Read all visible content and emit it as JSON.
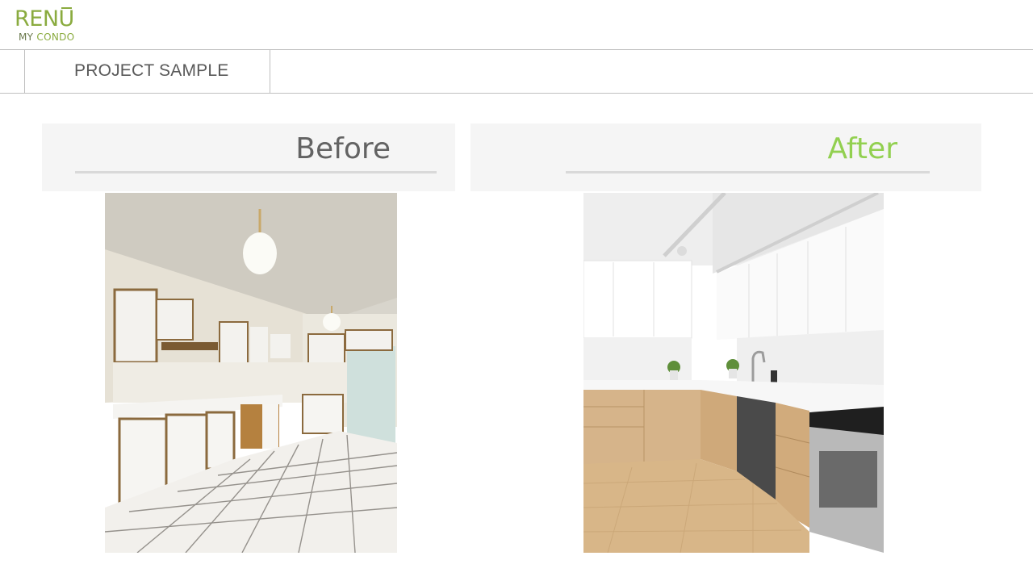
{
  "logo": {
    "brand_prefix": "REN",
    "brand_suffix": "U",
    "tagline_my": "MY",
    "tagline_condo": "CONDO",
    "color": "#8aab3f"
  },
  "header": {
    "section_title": "PROJECT SAMPLE"
  },
  "comparison": {
    "before_label": "Before",
    "after_label": "After",
    "before_label_color": "#636363",
    "after_label_color": "#92d050"
  },
  "images": {
    "before": "kitchen-before-photo",
    "after": "kitchen-after-photo"
  }
}
